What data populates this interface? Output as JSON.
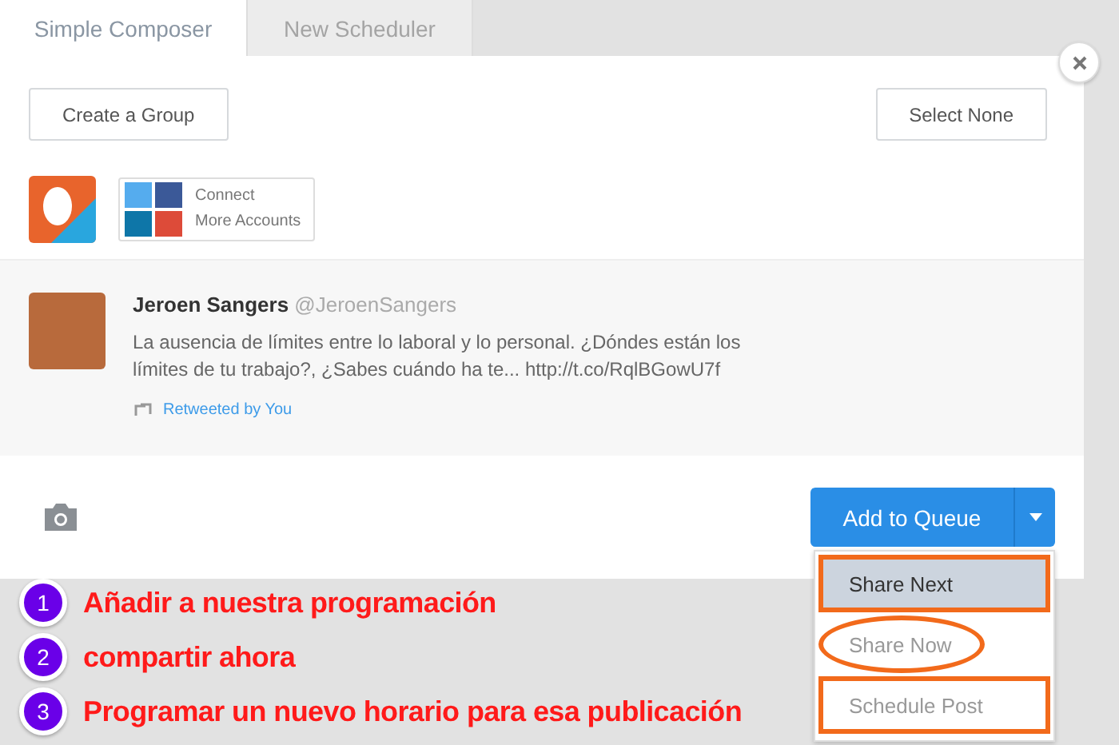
{
  "tabs": [
    {
      "label": "Simple Composer",
      "selected": true
    },
    {
      "label": "New Scheduler",
      "selected": false
    }
  ],
  "toolbar": {
    "create_group": "Create a Group",
    "select_none": "Select None"
  },
  "connect": {
    "line_1": "Connect",
    "line_2": "More Accounts"
  },
  "tweet": {
    "name": "Jeroen Sangers",
    "handle": "@JeroenSangers",
    "text": "La ausencia de límites entre lo laboral y lo personal. ¿Dóndes están los límites de tu trabajo?, ¿Sabes cuándo ha te... http://t.co/RqlBGowU7f",
    "retweet": "Retweeted by You"
  },
  "primary_button": "Add to Queue",
  "dropdown": [
    {
      "label": "Share Next",
      "selected": true,
      "kind": "rect"
    },
    {
      "label": "Share Now",
      "selected": false,
      "kind": "ellipse"
    },
    {
      "label": "Schedule Post",
      "selected": false,
      "kind": "rect"
    }
  ],
  "annotations": [
    {
      "number": "1",
      "text": "Añadir a nuestra programación"
    },
    {
      "number": "2",
      "text": "compartir ahora"
    },
    {
      "number": "3",
      "text": "Programar un nuevo horario para esa publicación"
    }
  ]
}
